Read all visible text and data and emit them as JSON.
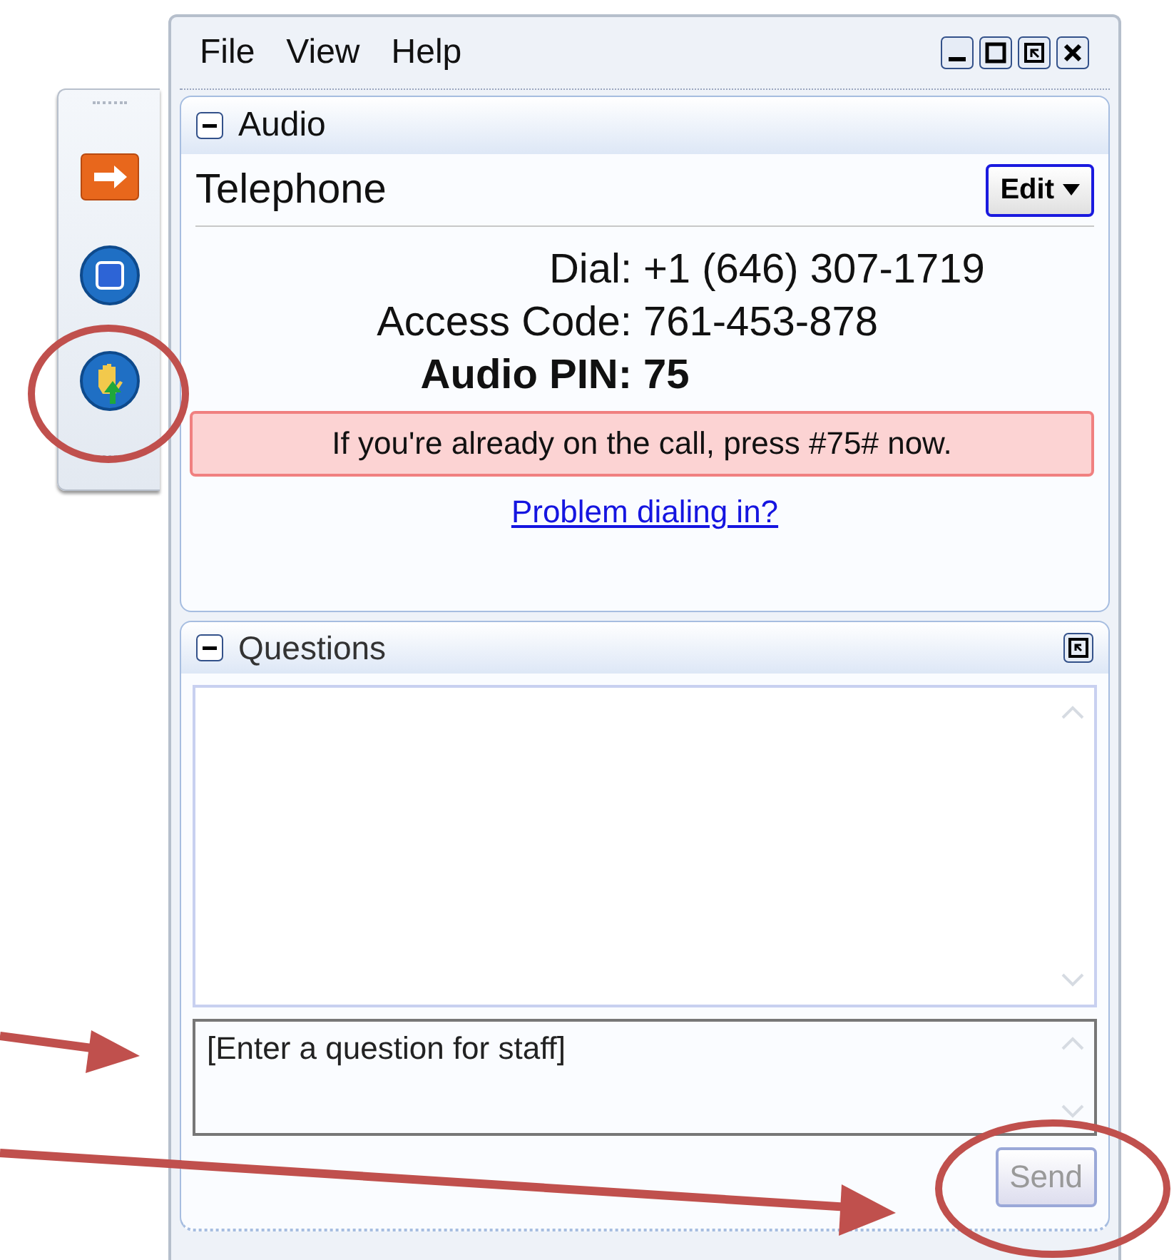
{
  "toolbar": {
    "buttons": [
      {
        "kind": "arrow"
      },
      {
        "kind": "stop"
      },
      {
        "kind": "hand"
      }
    ]
  },
  "menu": [
    "File",
    "View",
    "Help"
  ],
  "window_controls": [
    {
      "kind": "minimize"
    },
    {
      "kind": "maximize"
    },
    {
      "kind": "restore"
    },
    {
      "kind": "close"
    }
  ],
  "audio": {
    "title": "Audio",
    "expanded": true,
    "mode": "Telephone",
    "edit_button": "Edit",
    "lines": [
      {
        "label": "Dial:",
        "value": "+1 (646) 307-1719",
        "bold": false
      },
      {
        "label": "Access Code:",
        "value": "761-453-878",
        "bold": false
      },
      {
        "label": "Audio PIN:",
        "value": "75",
        "bold": true
      }
    ],
    "notice": "If you're already on the call, press #75# now.",
    "link": "Problem dialing in?"
  },
  "questions": {
    "title": "Questions",
    "expanded": true,
    "input": {
      "placeholder": "[Enter a question for staff]"
    },
    "send_button": {
      "label": "Send",
      "disabled": true
    }
  }
}
